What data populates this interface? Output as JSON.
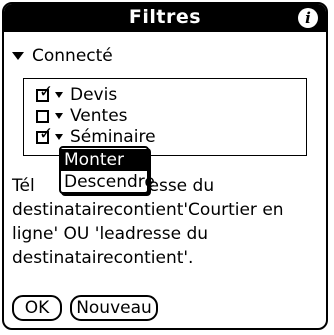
{
  "window": {
    "title": "Filtres",
    "info_icon": "i"
  },
  "group": {
    "label": "Connecté",
    "icon": "triangle-down-icon"
  },
  "filters": [
    {
      "label": "Devis",
      "checked": true
    },
    {
      "label": "Ventes",
      "checked": false
    },
    {
      "label": "Séminaire",
      "checked": true
    }
  ],
  "description": "Tél ... adresse du destinatairecontient'Courtier en ligne' OU 'leadresse du destinatairecontient'.",
  "description_lines": [
    "Tél",
    "adresse du",
    "destinatairecontient'Courtier en",
    "ligne' OU 'leadresse du",
    "destinatairecontient'."
  ],
  "popup_menu": {
    "items": [
      "Monter",
      "Descendre"
    ],
    "selected_index": 0
  },
  "buttons": {
    "ok_label": "OK",
    "new_label": "Nouveau"
  }
}
